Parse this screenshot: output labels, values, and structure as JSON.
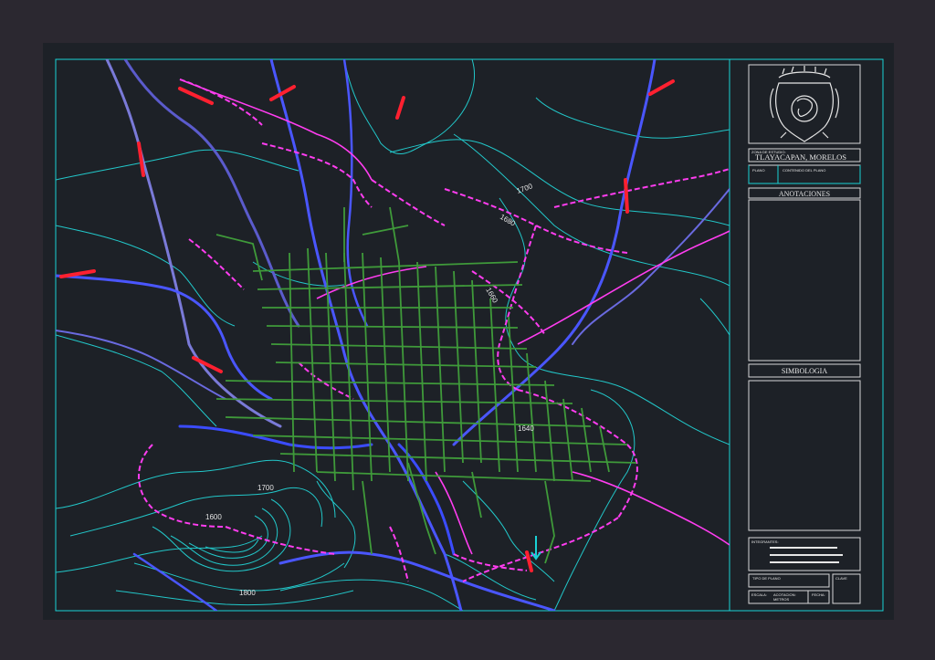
{
  "title_block": {
    "zone_label": "ZONA DE ESTUDIO:",
    "location": "TLAYACAPAN, MORELOS",
    "plan_label": "PLANO",
    "content_label": "CONTENIDO DEL PLANO",
    "annotations_header": "ANOTACIONES",
    "symbology_header": "SIMBOLOGIA",
    "members_label": "INTEGRANTES:",
    "plan_type_label": "TIPO DE PLANO",
    "key_label": "CLAVE",
    "scale_label": "ESCALA:",
    "scale_value": "ACOTACION:",
    "units_value": "METROS",
    "date_label": "FECHA:"
  },
  "map": {
    "contour_labels": [
      "1700",
      "1680",
      "1660",
      "1640",
      "1700",
      "1600",
      "1800"
    ],
    "colors": {
      "streets": "#3f9a3a",
      "boundary": "#ff3df0",
      "contours": "#22c7c9",
      "rivers": "#3b4cff",
      "roads_main": "#7a7ad8",
      "markers": "#ff2030",
      "frame": "#19d2d6"
    }
  }
}
